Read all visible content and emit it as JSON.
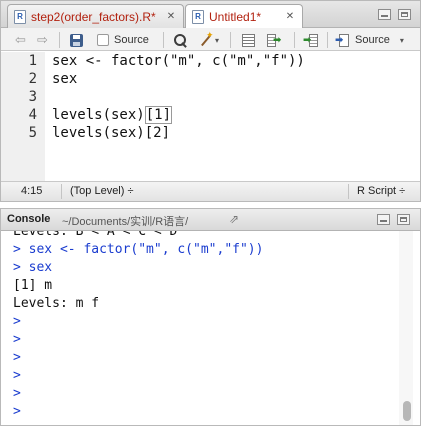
{
  "editor": {
    "tabs": [
      {
        "label": "step2(order_factors).R*",
        "active": false
      },
      {
        "label": "Untitled1*",
        "active": true
      }
    ],
    "toolbar": {
      "source_on_save_label": "Source",
      "source_button_label": "Source"
    },
    "code_lines": [
      {
        "num": "1",
        "text": "sex <- factor(\"m\", c(\"m\",\"f\"))"
      },
      {
        "num": "2",
        "text": "sex"
      },
      {
        "num": "3",
        "text": ""
      },
      {
        "num": "4",
        "text_before": "levels(sex)",
        "bracket": "[1]"
      },
      {
        "num": "5",
        "text": "levels(sex)[2]"
      }
    ],
    "status": {
      "cursor": "4:15",
      "scope": "(Top Level) ÷",
      "filetype": "R Script ÷"
    }
  },
  "console": {
    "title": "Console",
    "path": "~/Documents/实训/R语言/",
    "lines": [
      {
        "kind": "out",
        "text": "Levels: B < A < C < D"
      },
      {
        "kind": "in",
        "text": "> sex <- factor(\"m\", c(\"m\",\"f\"))"
      },
      {
        "kind": "in",
        "text": "> sex"
      },
      {
        "kind": "out",
        "text": "[1] m"
      },
      {
        "kind": "out",
        "text": "Levels: m f"
      },
      {
        "kind": "in",
        "text": ">"
      },
      {
        "kind": "in",
        "text": ">"
      },
      {
        "kind": "in",
        "text": ">"
      },
      {
        "kind": "in",
        "text": ">"
      },
      {
        "kind": "in",
        "text": ">"
      },
      {
        "kind": "in",
        "text": ">"
      }
    ]
  },
  "colors": {
    "tab_text": "#b2210f",
    "console_input": "#1a3ccf",
    "gutter_bg": "#f0f0f0"
  }
}
